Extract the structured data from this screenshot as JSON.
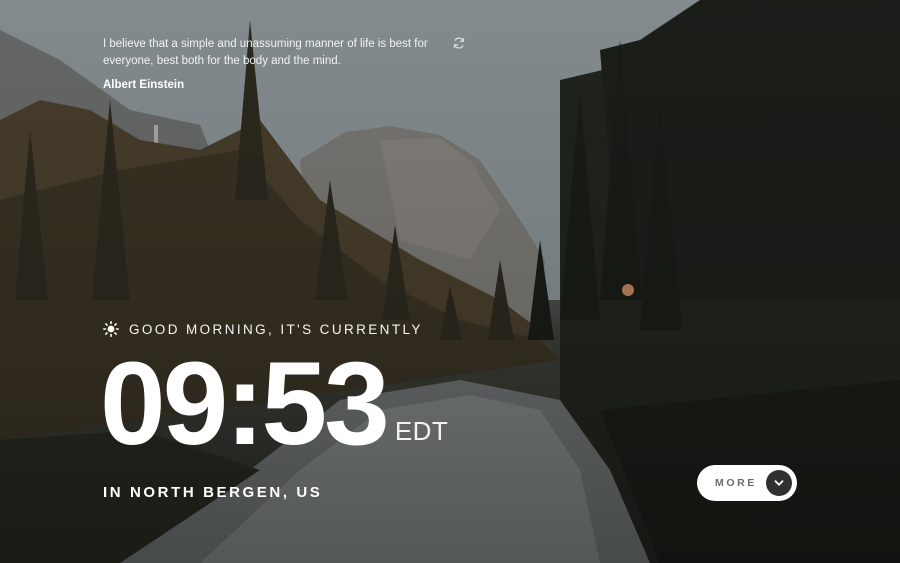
{
  "quote": {
    "text": "I believe that a simple and unassuming manner of life is best for everyone, best both for the body and the mind.",
    "author": "Albert Einstein",
    "refresh_icon": "refresh-icon"
  },
  "greeting": {
    "icon": "sun-icon",
    "text": "GOOD MORNING, IT'S CURRENTLY"
  },
  "clock": {
    "time": "09:53",
    "timezone": "EDT"
  },
  "location": {
    "text": "IN NORTH BERGEN, US"
  },
  "more_button": {
    "label": "MORE",
    "icon": "chevron-down-icon"
  },
  "colors": {
    "text": "#ffffff",
    "button_bg": "#ffffff",
    "button_text": "#6b6b6b",
    "button_circle": "#303030"
  }
}
